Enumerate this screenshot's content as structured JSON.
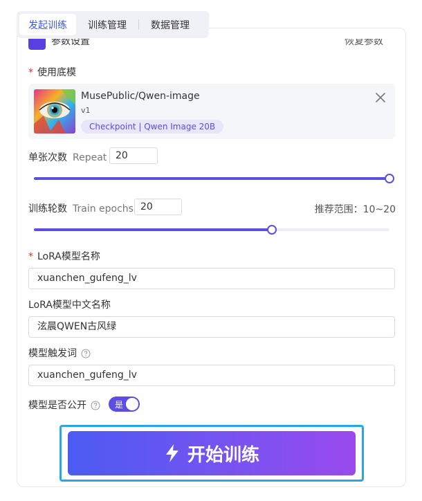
{
  "tabs": [
    {
      "label": "发起训练",
      "active": true
    },
    {
      "label": "训练管理",
      "active": false
    },
    {
      "label": "数据管理",
      "active": false
    }
  ],
  "base_model": {
    "label": "使用底模",
    "required": true,
    "name": "MusePublic/Qwen-image",
    "version": "v1",
    "tag": "Checkpoint | Qwen Image 20B"
  },
  "repeat": {
    "label": "单张次数",
    "sub_label": "Repeat",
    "value": "20",
    "slider_fraction": 1.0
  },
  "epochs": {
    "label": "训练轮数",
    "sub_label": "Train epochs",
    "value": "20",
    "slider_fraction": 0.67,
    "hint": "推荐范围：10~20"
  },
  "lora_name": {
    "label": "LoRA模型名称",
    "required": true,
    "value": "xuanchen_gufeng_lv"
  },
  "lora_cn_name": {
    "label": "LoRA模型中文名称",
    "value": "泫晨QWEN古风绿"
  },
  "trigger_word": {
    "label": "模型触发词",
    "value": "xuanchen_gufeng_lv"
  },
  "public": {
    "label": "模型是否公开",
    "switch_text": "是",
    "on": true
  },
  "train_button": {
    "label": "开始训练"
  },
  "colors": {
    "accent": "#5b4ee0",
    "tab_active": "#3b58e8",
    "required": "#e0352b",
    "button_gradient_start": "#4b5bf2",
    "button_gradient_end": "#9a49ee",
    "focus_frame": "#2aa5ea"
  },
  "icons": {
    "close": "close-icon",
    "help": "question-circle-icon",
    "lightning": "lightning-icon"
  }
}
